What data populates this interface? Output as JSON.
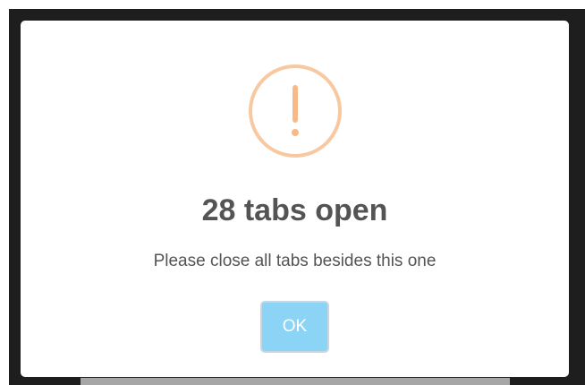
{
  "dialog": {
    "icon": "warning-exclamation-icon",
    "title": "28 tabs open",
    "message": "Please close all tabs besides this one",
    "ok_label": "OK"
  },
  "colors": {
    "warning_accent": "#f8c9a0",
    "ok_button": "#8cd4f5",
    "text": "#545454",
    "backdrop": "#1e1e1e"
  }
}
